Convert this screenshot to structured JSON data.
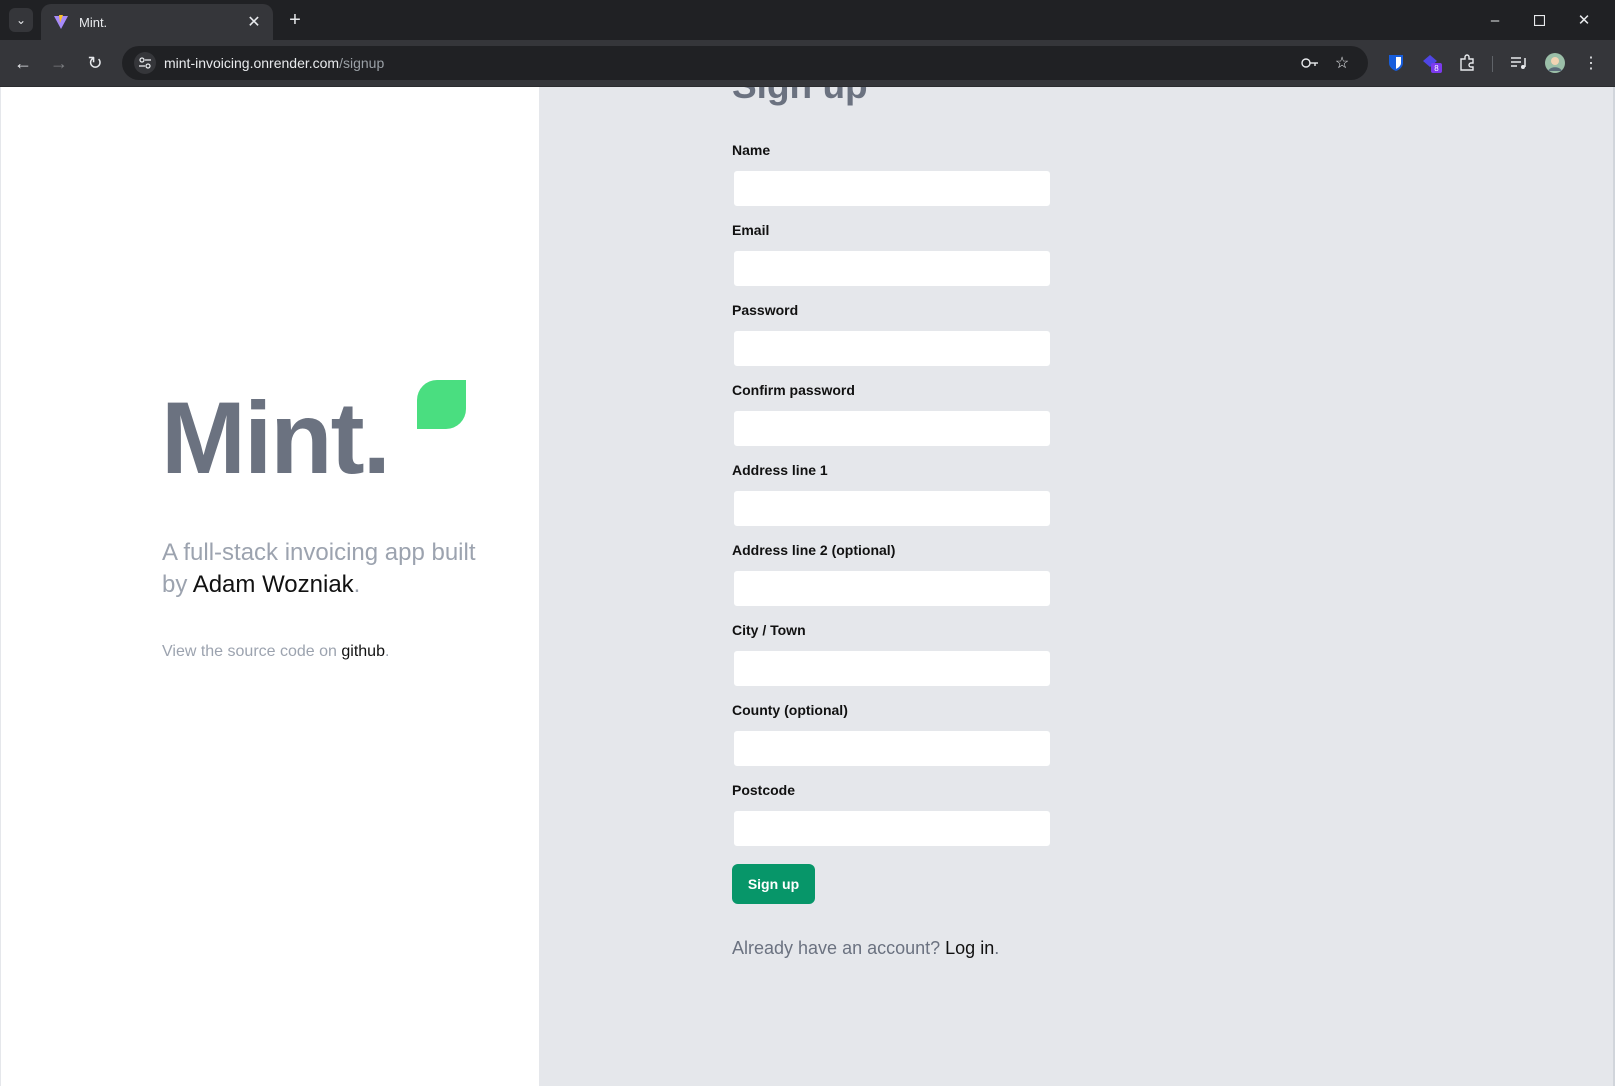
{
  "browser": {
    "tab_title": "Mint.",
    "url_host": "mint-invoicing.onrender.com",
    "url_path": "/signup",
    "extension_badge": "8",
    "icons": [
      "tab-search-icon",
      "close-icon",
      "plus-icon",
      "minimize-icon",
      "maximize-icon",
      "back-icon",
      "forward-icon",
      "reload-icon",
      "site-info-icon",
      "key-icon",
      "star-icon",
      "bitwarden-icon",
      "extension-icon",
      "puzzle-icon",
      "media-icon",
      "avatar",
      "menu-icon"
    ]
  },
  "brand": {
    "logo": "Mint.",
    "tagline_prefix": "A full-stack invoicing app built by ",
    "author": "Adam Wozniak",
    "tagline_suffix": ".",
    "source_prefix": "View the source code on ",
    "source_link": "github",
    "source_suffix": ".",
    "accent_color": "#4ade80",
    "text_color": "#6b7280"
  },
  "form": {
    "title": "Sign up",
    "fields": [
      {
        "label": "Name"
      },
      {
        "label": "Email"
      },
      {
        "label": "Password"
      },
      {
        "label": "Confirm password"
      },
      {
        "label": "Address line 1"
      },
      {
        "label": "Address line 2 (optional)"
      },
      {
        "label": "City / Town"
      },
      {
        "label": "County (optional)"
      },
      {
        "label": "Postcode"
      }
    ],
    "submit_label": "Sign up",
    "button_color": "#079669",
    "login_prefix": "Already have an account? ",
    "login_link": "Log in",
    "login_suffix": "."
  }
}
